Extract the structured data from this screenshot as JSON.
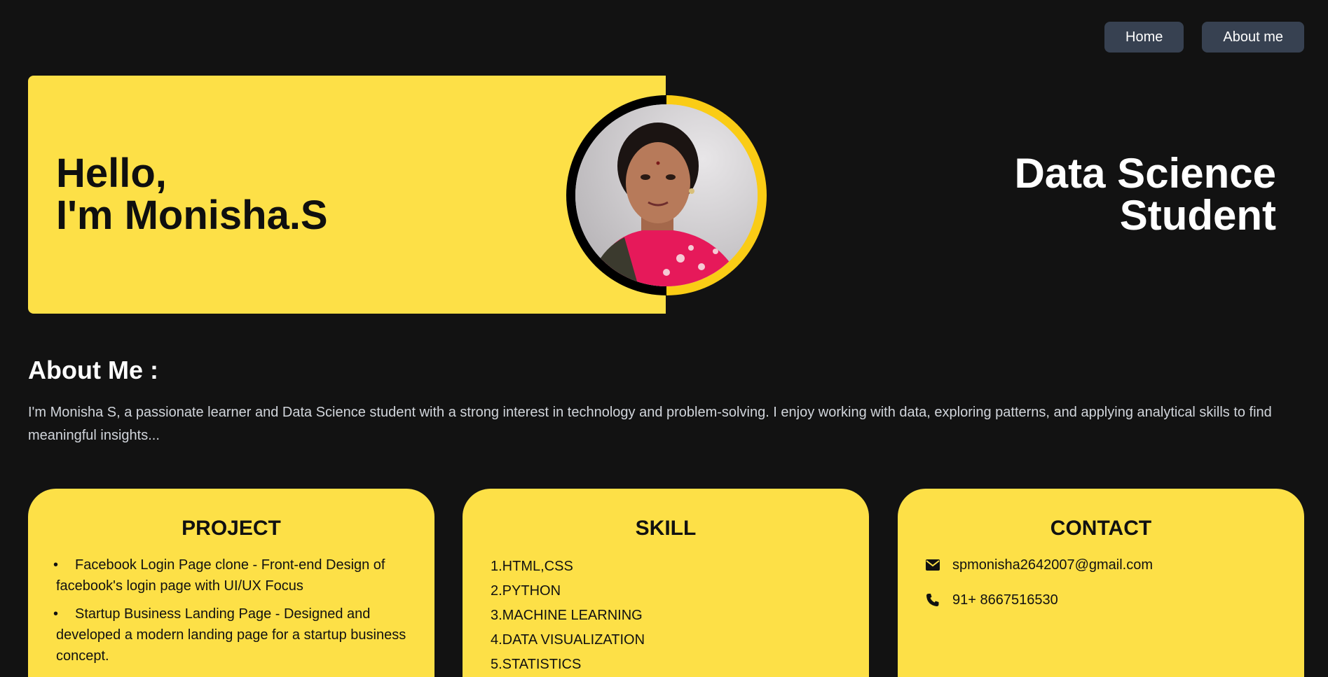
{
  "nav": {
    "home_label": "Home",
    "about_label": "About me"
  },
  "hero": {
    "greeting_line1": "Hello,",
    "greeting_line2": "I'm Monisha.S",
    "title_line1": "Data Science",
    "title_line2": "Student",
    "accent_color": "#FDE047"
  },
  "about": {
    "heading": "About Me :",
    "text": "I'm Monisha S, a passionate learner and Data Science student with a strong interest in technology and problem-solving. I enjoy working with data, exploring patterns, and applying analytical skills to find meaningful insights..."
  },
  "project": {
    "title": "PROJECT",
    "items": [
      "Facebook Login Page clone - Front-end Design of facebook's login page with UI/UX Focus",
      "Startup Business Landing Page - Designed and developed a modern landing page for a startup business concept."
    ]
  },
  "skill": {
    "title": "SKILL",
    "items": [
      "1.HTML,CSS",
      "2.PYTHON",
      "3.MACHINE LEARNING",
      "4.DATA VISUALIZATION",
      "5.STATISTICS"
    ]
  },
  "contact": {
    "title": "CONTACT",
    "email": "spmonisha2642007@gmail.com",
    "phone": "91+ 8667516530",
    "email_icon": "envelope-icon",
    "phone_icon": "phone-icon"
  }
}
